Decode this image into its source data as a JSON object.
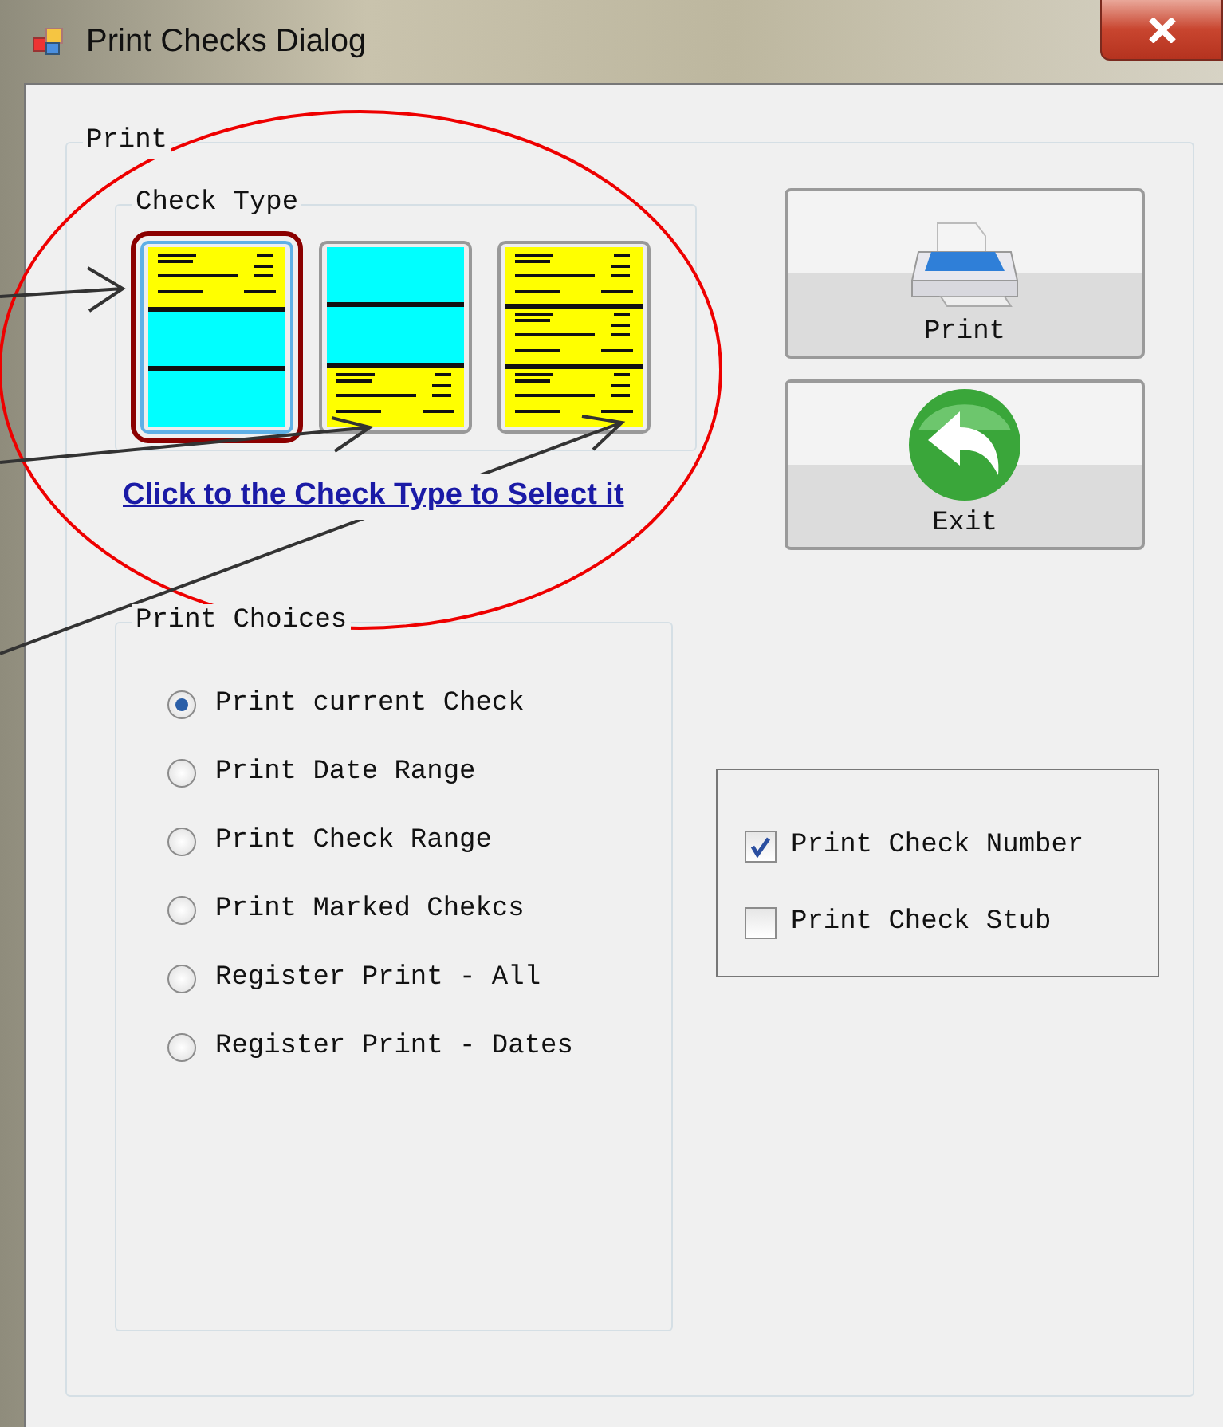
{
  "window": {
    "title": "Print Checks Dialog"
  },
  "print_group": {
    "label": "Print"
  },
  "check_type": {
    "label": "Check Type",
    "options": [
      {
        "kind": "top",
        "selected": true
      },
      {
        "kind": "bottom",
        "selected": false
      },
      {
        "kind": "three",
        "selected": false
      }
    ],
    "hint_link": "Click to the Check Type to Select it"
  },
  "buttons": [
    {
      "kind": "print",
      "label": "Print"
    },
    {
      "kind": "exit",
      "label": "Exit"
    }
  ],
  "print_choices": {
    "label": "Print Choices",
    "options": [
      {
        "label": "Print current Check",
        "selected": true
      },
      {
        "label": "Print Date Range",
        "selected": false
      },
      {
        "label": "Print Check Range",
        "selected": false
      },
      {
        "label": "Print Marked Chekcs",
        "selected": false
      },
      {
        "label": "Register Print - All",
        "selected": false
      },
      {
        "label": "Register Print - Dates",
        "selected": false
      }
    ]
  },
  "checkboxes": [
    {
      "label": "Print Check Number",
      "checked": true
    },
    {
      "label": "Print Check Stub",
      "checked": false
    }
  ]
}
